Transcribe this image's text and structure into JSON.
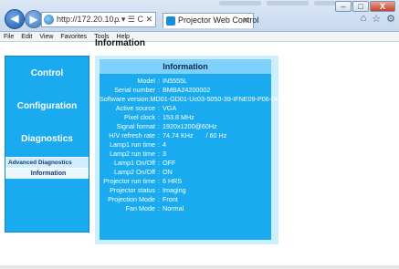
{
  "browser": {
    "address": "http://172.20.10...",
    "address_controls": "ρ ▾ ☰ C ✕",
    "tab_title": "Projector Web Control",
    "tab_close": "✕",
    "win_min": "–",
    "win_max": "□",
    "win_close": "X",
    "toolbar_icons": [
      "home-icon",
      "star-icon",
      "gear-icon"
    ]
  },
  "menu": {
    "items": [
      {
        "label": "File"
      },
      {
        "label": "Edit"
      },
      {
        "label": "View"
      },
      {
        "label": "Favorites"
      },
      {
        "label": "Tools"
      },
      {
        "label": "Help"
      }
    ]
  },
  "page": {
    "title": "Information"
  },
  "sidebar": {
    "control": "Control",
    "configuration": "Configuration",
    "diagnostics": "Diagnostics",
    "advanced": "Advanced Diagnostics",
    "information": "Information"
  },
  "info": {
    "heading": "Information",
    "sep": ":",
    "rows": [
      {
        "label": "Model",
        "value": "IN5555L"
      },
      {
        "label": "Serial number",
        "value": "BMBA24200002"
      },
      {
        "label": "Software version",
        "value": "MD01-GD01-Uc03-5050-39-IFNE09-P06-D04"
      },
      {
        "label": "Active source",
        "value": "VGA"
      },
      {
        "label": "Pixel clock",
        "value": "153.8 MHz"
      },
      {
        "label": "Signal format",
        "value": "1920x1200@60Hz"
      },
      {
        "label": "H/V refresh rate",
        "value": "74.74 KHz",
        "value2": "/ 60 Hz"
      },
      {
        "label": "Lamp1 run time",
        "value": "4"
      },
      {
        "label": "Lamp2 run time",
        "value": "3"
      },
      {
        "label": "Lamp1 On/Off",
        "value": "OFF"
      },
      {
        "label": "Lamp2 On/Off",
        "value": "ON"
      },
      {
        "label": "Projector run time",
        "value": "6 HRS"
      },
      {
        "label": "Projector status",
        "value": "Imaging"
      },
      {
        "label": "Projection Mode",
        "value": "Front"
      },
      {
        "label": "Fan Mode",
        "value": "Normal"
      }
    ]
  },
  "colors": {
    "sidebar": "#19aaf0",
    "panel_bg": "#cdeeff",
    "panel_head": "#7fd0fa"
  }
}
